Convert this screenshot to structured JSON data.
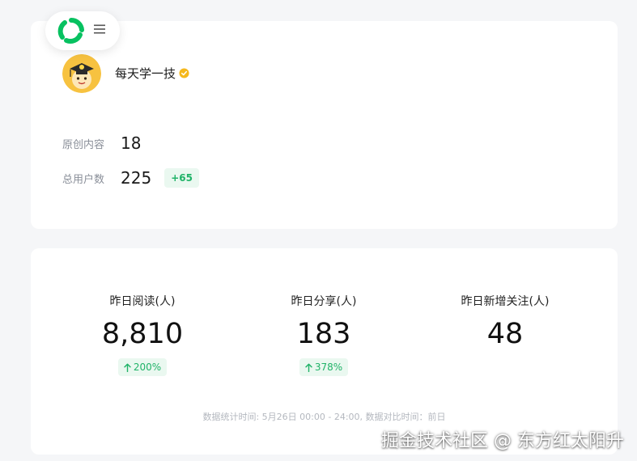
{
  "header": {
    "logo_icon": "wechat-official-accounts-logo",
    "menu_icon": "hamburger-menu-icon"
  },
  "profile": {
    "account_name": "每天学一技",
    "verified_icon": "verified-badge-icon",
    "verified_color": "#f5b81c",
    "stats": [
      {
        "label": "原创内容",
        "value": "18"
      },
      {
        "label": "总用户数",
        "value": "225",
        "delta": "+65"
      }
    ]
  },
  "metrics": [
    {
      "label": "昨日阅读(人)",
      "value": "8,810",
      "change": "200%",
      "trend": "up"
    },
    {
      "label": "昨日分享(人)",
      "value": "183",
      "change": "378%",
      "trend": "up"
    },
    {
      "label": "昨日新增关注(人)",
      "value": "48"
    }
  ],
  "footnote": "数据统计时间: 5月26日 00:00 - 24:00, 数据对比时间：前日",
  "watermark": "掘金技术社区 @ 东方红太阳升",
  "colors": {
    "accent_green": "#20b368",
    "badge_bg": "#eaf8f0",
    "page_bg": "#f5f6f8"
  }
}
